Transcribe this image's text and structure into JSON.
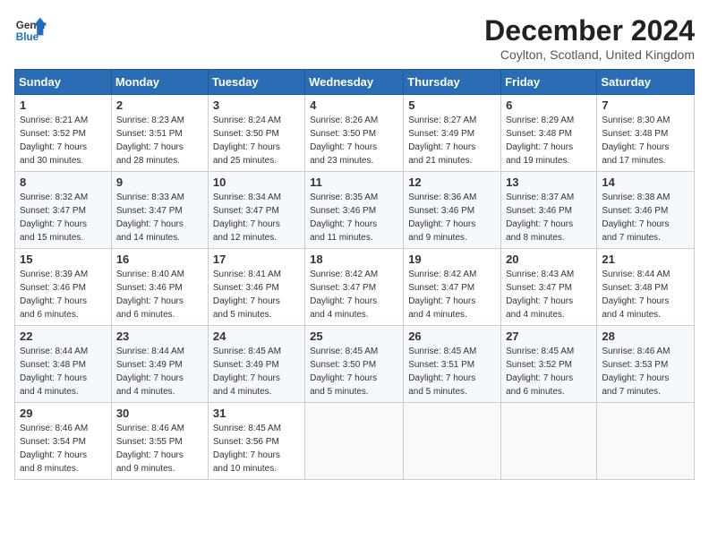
{
  "header": {
    "logo_line1": "General",
    "logo_line2": "Blue",
    "title": "December 2024",
    "location": "Coylton, Scotland, United Kingdom"
  },
  "weekdays": [
    "Sunday",
    "Monday",
    "Tuesday",
    "Wednesday",
    "Thursday",
    "Friday",
    "Saturday"
  ],
  "weeks": [
    [
      {
        "day": "1",
        "info": "Sunrise: 8:21 AM\nSunset: 3:52 PM\nDaylight: 7 hours\nand 30 minutes."
      },
      {
        "day": "2",
        "info": "Sunrise: 8:23 AM\nSunset: 3:51 PM\nDaylight: 7 hours\nand 28 minutes."
      },
      {
        "day": "3",
        "info": "Sunrise: 8:24 AM\nSunset: 3:50 PM\nDaylight: 7 hours\nand 25 minutes."
      },
      {
        "day": "4",
        "info": "Sunrise: 8:26 AM\nSunset: 3:50 PM\nDaylight: 7 hours\nand 23 minutes."
      },
      {
        "day": "5",
        "info": "Sunrise: 8:27 AM\nSunset: 3:49 PM\nDaylight: 7 hours\nand 21 minutes."
      },
      {
        "day": "6",
        "info": "Sunrise: 8:29 AM\nSunset: 3:48 PM\nDaylight: 7 hours\nand 19 minutes."
      },
      {
        "day": "7",
        "info": "Sunrise: 8:30 AM\nSunset: 3:48 PM\nDaylight: 7 hours\nand 17 minutes."
      }
    ],
    [
      {
        "day": "8",
        "info": "Sunrise: 8:32 AM\nSunset: 3:47 PM\nDaylight: 7 hours\nand 15 minutes."
      },
      {
        "day": "9",
        "info": "Sunrise: 8:33 AM\nSunset: 3:47 PM\nDaylight: 7 hours\nand 14 minutes."
      },
      {
        "day": "10",
        "info": "Sunrise: 8:34 AM\nSunset: 3:47 PM\nDaylight: 7 hours\nand 12 minutes."
      },
      {
        "day": "11",
        "info": "Sunrise: 8:35 AM\nSunset: 3:46 PM\nDaylight: 7 hours\nand 11 minutes."
      },
      {
        "day": "12",
        "info": "Sunrise: 8:36 AM\nSunset: 3:46 PM\nDaylight: 7 hours\nand 9 minutes."
      },
      {
        "day": "13",
        "info": "Sunrise: 8:37 AM\nSunset: 3:46 PM\nDaylight: 7 hours\nand 8 minutes."
      },
      {
        "day": "14",
        "info": "Sunrise: 8:38 AM\nSunset: 3:46 PM\nDaylight: 7 hours\nand 7 minutes."
      }
    ],
    [
      {
        "day": "15",
        "info": "Sunrise: 8:39 AM\nSunset: 3:46 PM\nDaylight: 7 hours\nand 6 minutes."
      },
      {
        "day": "16",
        "info": "Sunrise: 8:40 AM\nSunset: 3:46 PM\nDaylight: 7 hours\nand 6 minutes."
      },
      {
        "day": "17",
        "info": "Sunrise: 8:41 AM\nSunset: 3:46 PM\nDaylight: 7 hours\nand 5 minutes."
      },
      {
        "day": "18",
        "info": "Sunrise: 8:42 AM\nSunset: 3:47 PM\nDaylight: 7 hours\nand 4 minutes."
      },
      {
        "day": "19",
        "info": "Sunrise: 8:42 AM\nSunset: 3:47 PM\nDaylight: 7 hours\nand 4 minutes."
      },
      {
        "day": "20",
        "info": "Sunrise: 8:43 AM\nSunset: 3:47 PM\nDaylight: 7 hours\nand 4 minutes."
      },
      {
        "day": "21",
        "info": "Sunrise: 8:44 AM\nSunset: 3:48 PM\nDaylight: 7 hours\nand 4 minutes."
      }
    ],
    [
      {
        "day": "22",
        "info": "Sunrise: 8:44 AM\nSunset: 3:48 PM\nDaylight: 7 hours\nand 4 minutes."
      },
      {
        "day": "23",
        "info": "Sunrise: 8:44 AM\nSunset: 3:49 PM\nDaylight: 7 hours\nand 4 minutes."
      },
      {
        "day": "24",
        "info": "Sunrise: 8:45 AM\nSunset: 3:49 PM\nDaylight: 7 hours\nand 4 minutes."
      },
      {
        "day": "25",
        "info": "Sunrise: 8:45 AM\nSunset: 3:50 PM\nDaylight: 7 hours\nand 5 minutes."
      },
      {
        "day": "26",
        "info": "Sunrise: 8:45 AM\nSunset: 3:51 PM\nDaylight: 7 hours\nand 5 minutes."
      },
      {
        "day": "27",
        "info": "Sunrise: 8:45 AM\nSunset: 3:52 PM\nDaylight: 7 hours\nand 6 minutes."
      },
      {
        "day": "28",
        "info": "Sunrise: 8:46 AM\nSunset: 3:53 PM\nDaylight: 7 hours\nand 7 minutes."
      }
    ],
    [
      {
        "day": "29",
        "info": "Sunrise: 8:46 AM\nSunset: 3:54 PM\nDaylight: 7 hours\nand 8 minutes."
      },
      {
        "day": "30",
        "info": "Sunrise: 8:46 AM\nSunset: 3:55 PM\nDaylight: 7 hours\nand 9 minutes."
      },
      {
        "day": "31",
        "info": "Sunrise: 8:45 AM\nSunset: 3:56 PM\nDaylight: 7 hours\nand 10 minutes."
      },
      null,
      null,
      null,
      null
    ]
  ]
}
